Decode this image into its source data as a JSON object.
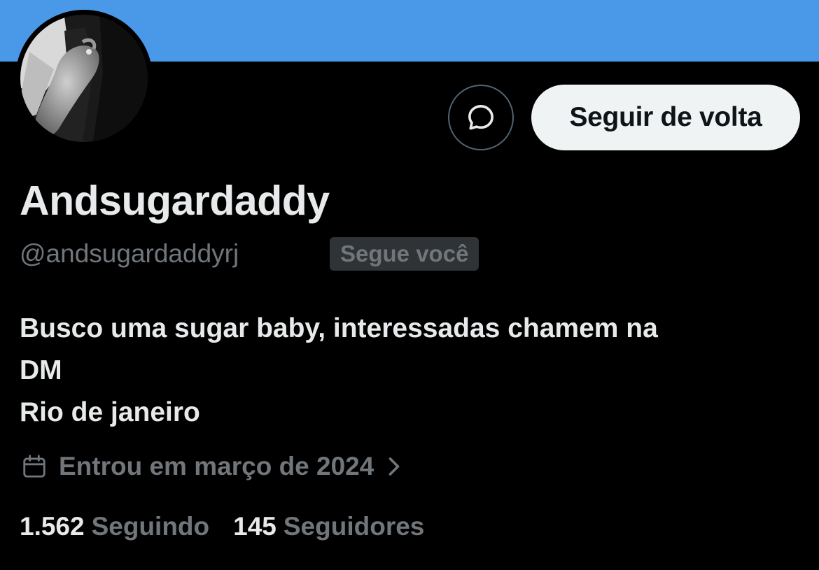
{
  "profile": {
    "display_name": "Andsugardaddy",
    "handle": "@andsugardaddyrj",
    "follows_you_badge": "Segue você",
    "bio_lines": [
      "Busco uma sugar baby, interessadas chamem na",
      "DM",
      "Rio de janeiro"
    ],
    "joined": "Entrou em março de 2024",
    "following_count": "1.562",
    "following_label": "Seguindo",
    "followers_count": "145",
    "followers_label": "Seguidores"
  },
  "actions": {
    "follow_back_label": "Seguir de volta",
    "message_icon": "message-bubble-icon"
  },
  "icons": {
    "calendar": "calendar-icon",
    "chevron": "chevron-right-icon"
  },
  "colors": {
    "banner": "#4a99e9",
    "background": "#000000",
    "primary_text": "#e7e9ea",
    "secondary_text": "#71767b",
    "button_bg": "#eff3f4",
    "badge_bg": "#2f3336"
  }
}
